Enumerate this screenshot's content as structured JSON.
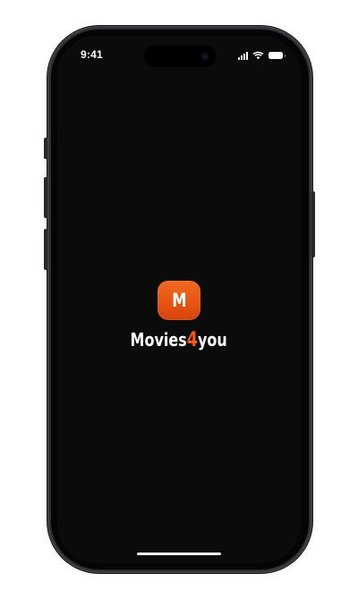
{
  "status_bar": {
    "time": "9:41",
    "icons": [
      "signal-icon",
      "wifi-icon",
      "battery-icon"
    ]
  },
  "splash": {
    "app_icon_letter": "M",
    "app_name_part1": "Movies",
    "app_name_accent": "4",
    "app_name_part2": "you"
  },
  "colors": {
    "screen_background": "#0b0b0b",
    "brand_orange": "#ff5a00",
    "icon_gradient_top": "#f26a1f",
    "icon_gradient_bottom": "#d9440b",
    "text": "#ffffff"
  }
}
